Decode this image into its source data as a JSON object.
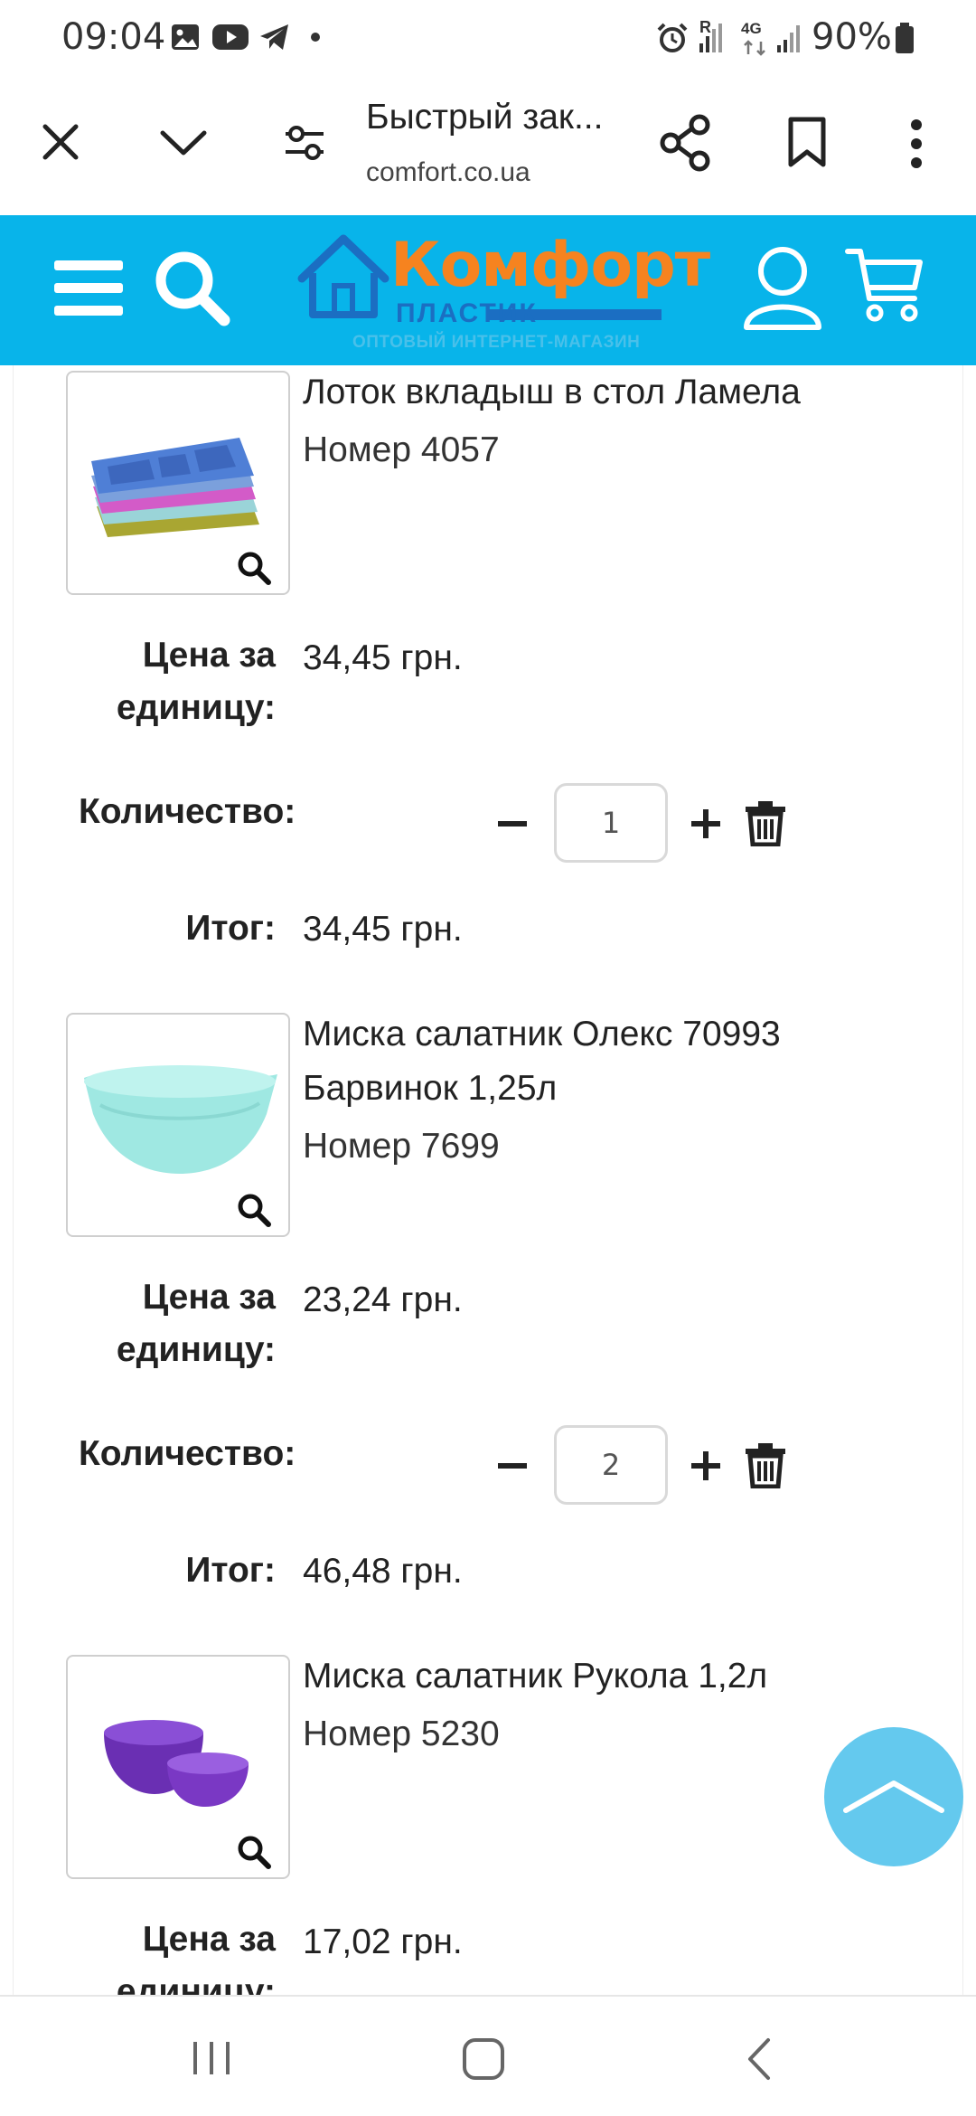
{
  "status_bar": {
    "time": "09:04",
    "battery": "90%",
    "network_label": "4G",
    "roaming_label": "R"
  },
  "browser": {
    "title": "Быстрый зак...",
    "domain": "comfort.co.ua",
    "icons": [
      "close-icon",
      "chevron-down-icon",
      "page-settings-icon",
      "share-icon",
      "bookmark-icon",
      "more-vert-icon"
    ]
  },
  "site_header": {
    "logo_main": "Комфорт",
    "logo_sub": "ПЛАСТИК",
    "logo_tagline": "ОПТОВЫЙ ИНТЕРНЕТ-МАГАЗИН",
    "accent_color": "#08b4ea",
    "logo_color": "#f6831f",
    "icons": [
      "menu-icon",
      "search-icon",
      "user-icon",
      "cart-icon"
    ]
  },
  "labels": {
    "price_per_unit_line1": "Цена за",
    "price_per_unit_line2": "единицу:",
    "quantity": "Количество:",
    "total": "Итог:"
  },
  "items": [
    {
      "name": "Лоток вкладыш в стол Ламела",
      "number": "Номер 4057",
      "price": "34,45 грн.",
      "quantity": "1",
      "total": "34,45 грн."
    },
    {
      "name": "Миска салатник Олекс 70993 Барвинок 1,25л",
      "number": "Номер 7699",
      "price": "23,24 грн.",
      "quantity": "2",
      "total": "46,48 грн."
    },
    {
      "name": "Миска салатник Рукола 1,2л",
      "number": "Номер 5230",
      "price": "17,02 грн."
    }
  ]
}
